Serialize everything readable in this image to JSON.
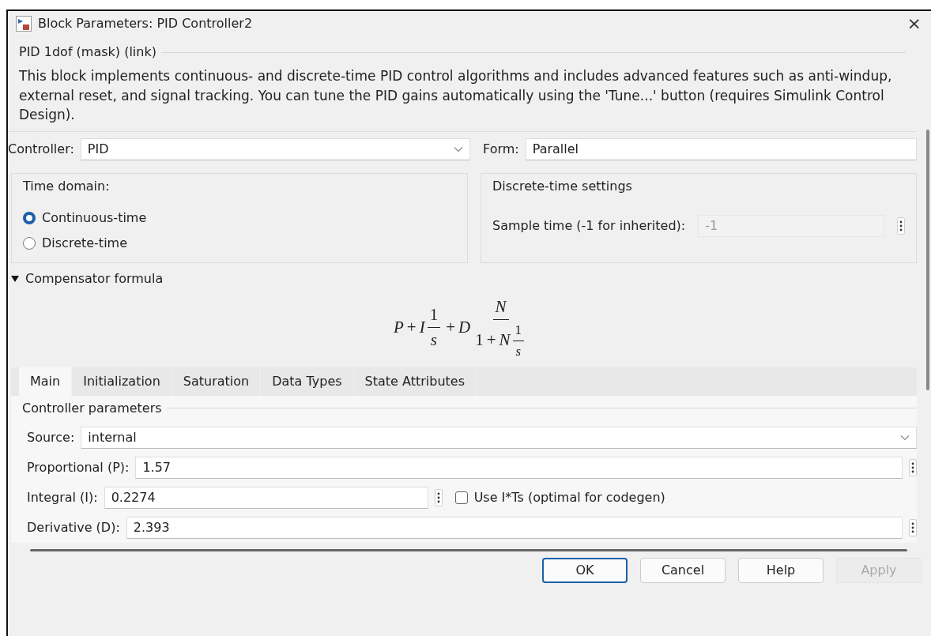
{
  "window": {
    "title": "Block Parameters: PID Controller2",
    "close": "×"
  },
  "mask_title": "PID 1dof (mask) (link)",
  "description": "This block implements continuous- and discrete-time PID control algorithms and includes advanced features such as anti-windup, external reset, and signal tracking. You can tune the PID gains automatically using the 'Tune...' button (requires Simulink Control Design).",
  "controller": {
    "label": "Controller:",
    "value": "PID"
  },
  "form": {
    "label": "Form:",
    "value": "Parallel"
  },
  "time_domain": {
    "title": "Time domain:",
    "options": [
      {
        "label": "Continuous-time",
        "selected": true
      },
      {
        "label": "Discrete-time",
        "selected": false
      }
    ]
  },
  "discrete_settings": {
    "title": "Discrete-time settings",
    "label": "Sample time (-1 for inherited):",
    "value": "-1",
    "disabled": true
  },
  "compensator": {
    "label": "Compensator formula",
    "expanded": true,
    "formula": [
      {
        "kind": "text",
        "text": "P"
      },
      {
        "kind": "op",
        "text": "+"
      },
      {
        "kind": "text",
        "text": "I"
      },
      {
        "kind": "frac",
        "num": [
          {
            "kind": "num",
            "text": "1"
          }
        ],
        "den": [
          {
            "kind": "text",
            "text": "s"
          }
        ]
      },
      {
        "kind": "op",
        "text": "+"
      },
      {
        "kind": "text",
        "text": "D"
      },
      {
        "kind": "frac",
        "num": [
          {
            "kind": "text",
            "text": "N"
          }
        ],
        "den": [
          {
            "kind": "num",
            "text": "1"
          },
          {
            "kind": "op",
            "text": "+"
          },
          {
            "kind": "text",
            "text": "N"
          },
          {
            "kind": "frac",
            "num": [
              {
                "kind": "num",
                "text": "1"
              }
            ],
            "den": [
              {
                "kind": "text",
                "text": "s"
              }
            ]
          }
        ]
      }
    ]
  },
  "tabs": [
    {
      "label": "Main",
      "selected": true
    },
    {
      "label": "Initialization",
      "selected": false
    },
    {
      "label": "Saturation",
      "selected": false
    },
    {
      "label": "Data Types",
      "selected": false
    },
    {
      "label": "State Attributes",
      "selected": false
    }
  ],
  "controller_parameters": {
    "title": "Controller parameters",
    "fields": [
      {
        "kind": "select",
        "label": "Source:",
        "value": "internal"
      },
      {
        "kind": "input",
        "label": "Proportional (P):",
        "value": "1.57"
      },
      {
        "kind": "input_check",
        "label": "Integral (I):",
        "value": "0.2274",
        "check_label": "Use I*Ts (optimal for codegen)",
        "checked": false
      },
      {
        "kind": "input",
        "label": "Derivative (D):",
        "value": "2.393"
      }
    ]
  },
  "buttons": [
    {
      "label": "OK",
      "kind": "default",
      "disabled": false
    },
    {
      "label": "Cancel",
      "kind": "normal",
      "disabled": false
    },
    {
      "label": "Help",
      "kind": "normal",
      "disabled": false
    },
    {
      "label": "Apply",
      "kind": "normal",
      "disabled": true
    }
  ]
}
